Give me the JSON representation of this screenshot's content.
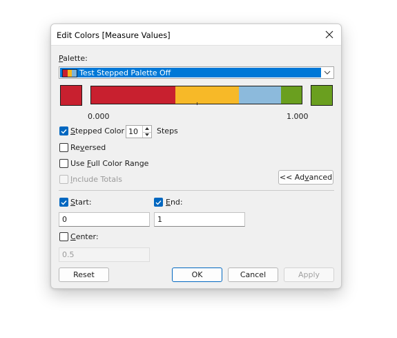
{
  "dialog": {
    "title": "Edit Colors [Measure Values]"
  },
  "palette": {
    "label": "Palette:",
    "selected": "Test Stepped Palette Off",
    "swatch_colors": [
      "#c8202f",
      "#f5b820",
      "#7db3d8"
    ]
  },
  "ramp": {
    "start_color": "#c8202f",
    "end_color": "#6a9f1f",
    "steps": [
      {
        "color": "#c8202f",
        "fraction": 0.4
      },
      {
        "color": "#f7b928",
        "fraction": 0.3
      },
      {
        "color": "#8cbadc",
        "fraction": 0.2
      },
      {
        "color": "#6a9f1f",
        "fraction": 0.1
      }
    ],
    "min_label": "0.000",
    "max_label": "1.000"
  },
  "stepped": {
    "label": "Stepped Color",
    "value": "10",
    "unit": "Steps",
    "checked": true
  },
  "reversed": {
    "label": "Reversed",
    "checked": false
  },
  "full_range": {
    "label": "Use Full Color Range",
    "checked": false
  },
  "include_totals": {
    "label": "Include Totals",
    "checked": false,
    "disabled": true
  },
  "advanced_button": "<< Advanced",
  "start": {
    "label": "Start:",
    "checked": true,
    "value": "0"
  },
  "end": {
    "label": "End:",
    "checked": true,
    "value": "1"
  },
  "center": {
    "label": "Center:",
    "checked": false,
    "value": "0.5"
  },
  "buttons": {
    "reset": "Reset",
    "ok": "OK",
    "cancel": "Cancel",
    "apply": "Apply"
  }
}
